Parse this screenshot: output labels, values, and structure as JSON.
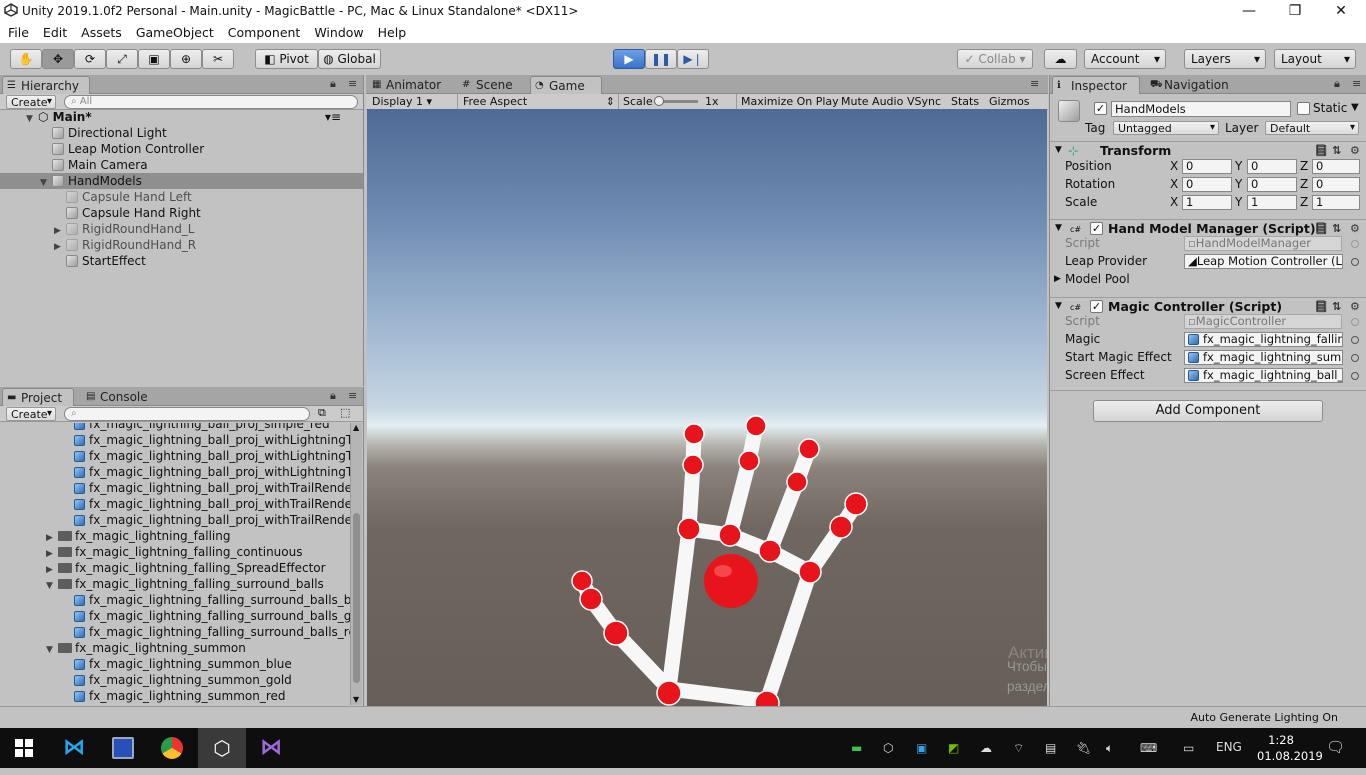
{
  "window": {
    "title": "Unity 2019.1.0f2 Personal - Main.unity - MagicBattle - PC, Mac & Linux Standalone* <DX11>",
    "controls": [
      "—",
      "❐",
      "✕"
    ]
  },
  "menu": [
    "File",
    "Edit",
    "Assets",
    "GameObject",
    "Component",
    "Window",
    "Help"
  ],
  "toolbar": {
    "pivot": "Pivot",
    "global": "Global",
    "collab": "Collab ▾",
    "account": "Account",
    "layers": "Layers",
    "layout": "Layout",
    "tool_icons": [
      "hand-tool-icon",
      "move-tool-icon",
      "rotate-tool-icon",
      "scale-tool-icon",
      "rect-tool-icon",
      "transform-tool-icon",
      "custom-tool-icon"
    ]
  },
  "hierarchy": {
    "tab": "Hierarchy",
    "create": "Create",
    "search_placeholder": "All",
    "scene": "Main*",
    "items": [
      {
        "label": "Directional Light",
        "depth": 1,
        "arrow": "",
        "faded": false,
        "selected": false
      },
      {
        "label": "Leap Motion Controller",
        "depth": 1,
        "arrow": "",
        "faded": false,
        "selected": false
      },
      {
        "label": "Main Camera",
        "depth": 1,
        "arrow": "",
        "faded": false,
        "selected": false
      },
      {
        "label": "HandModels",
        "depth": 1,
        "arrow": "▼",
        "faded": false,
        "selected": true
      },
      {
        "label": "Capsule Hand Left",
        "depth": 2,
        "arrow": "",
        "faded": true,
        "selected": false
      },
      {
        "label": "Capsule Hand Right",
        "depth": 2,
        "arrow": "",
        "faded": false,
        "selected": false
      },
      {
        "label": "RigidRoundHand_L",
        "depth": 2,
        "arrow": "▶",
        "faded": true,
        "selected": false
      },
      {
        "label": "RigidRoundHand_R",
        "depth": 2,
        "arrow": "▶",
        "faded": true,
        "selected": false
      },
      {
        "label": "StartEffect",
        "depth": 2,
        "arrow": "",
        "faded": false,
        "selected": false
      }
    ]
  },
  "project": {
    "tab": "Project",
    "console_tab": "Console",
    "create": "Create",
    "items": [
      {
        "label": "fx_magic_lightning_ball_proj_simple_red",
        "kind": "prefab",
        "arrow": ""
      },
      {
        "label": "fx_magic_lightning_ball_proj_withLightningTra",
        "kind": "prefab",
        "arrow": ""
      },
      {
        "label": "fx_magic_lightning_ball_proj_withLightningTra",
        "kind": "prefab",
        "arrow": ""
      },
      {
        "label": "fx_magic_lightning_ball_proj_withLightningTra",
        "kind": "prefab",
        "arrow": ""
      },
      {
        "label": "fx_magic_lightning_ball_proj_withTrailRender",
        "kind": "prefab",
        "arrow": ""
      },
      {
        "label": "fx_magic_lightning_ball_proj_withTrailRender",
        "kind": "prefab",
        "arrow": ""
      },
      {
        "label": "fx_magic_lightning_ball_proj_withTrailRender",
        "kind": "prefab",
        "arrow": ""
      },
      {
        "label": "fx_magic_lightning_falling",
        "kind": "folder",
        "arrow": "▶"
      },
      {
        "label": "fx_magic_lightning_falling_continuous",
        "kind": "folder",
        "arrow": "▶"
      },
      {
        "label": "fx_magic_lightning_falling_SpreadEffector",
        "kind": "folder",
        "arrow": "▶"
      },
      {
        "label": "fx_magic_lightning_falling_surround_balls",
        "kind": "folder",
        "arrow": "▼"
      },
      {
        "label": "fx_magic_lightning_falling_surround_balls_blu",
        "kind": "prefab",
        "arrow": ""
      },
      {
        "label": "fx_magic_lightning_falling_surround_balls_go",
        "kind": "prefab",
        "arrow": ""
      },
      {
        "label": "fx_magic_lightning_falling_surround_balls_re",
        "kind": "prefab",
        "arrow": ""
      },
      {
        "label": "fx_magic_lightning_summon",
        "kind": "folder",
        "arrow": "▼"
      },
      {
        "label": "fx_magic_lightning_summon_blue",
        "kind": "prefab",
        "arrow": ""
      },
      {
        "label": "fx_magic_lightning_summon_gold",
        "kind": "prefab",
        "arrow": ""
      },
      {
        "label": "fx_magic_lightning_summon_red",
        "kind": "prefab",
        "arrow": ""
      }
    ]
  },
  "center_tabs": {
    "animator": "Animator",
    "scene": "Scene",
    "game": "Game"
  },
  "game_bar": {
    "display": "Display 1",
    "aspect": "Free Aspect",
    "scale_label": "Scale",
    "scale_value": "1x",
    "maximize": "Maximize On Play",
    "mute": "Mute Audio",
    "vsync": "VSync",
    "stats": "Stats",
    "gizmos": "Gizmos"
  },
  "watermark": {
    "line1": "Активация Windows",
    "line2": "Чтобы активировать Windows, перейдите в",
    "line3": "раздел \"Параметры\"."
  },
  "inspector": {
    "tab": "Inspector",
    "nav_tab": "Navigation",
    "object_name": "HandModels",
    "static_label": "Static",
    "tag_label": "Tag",
    "tag_value": "Untagged",
    "layer_label": "Layer",
    "layer_value": "Default",
    "transform": {
      "title": "Transform",
      "rows": [
        {
          "label": "Position",
          "x": "0",
          "y": "0",
          "z": "0"
        },
        {
          "label": "Rotation",
          "x": "0",
          "y": "0",
          "z": "0"
        },
        {
          "label": "Scale",
          "x": "1",
          "y": "1",
          "z": "1"
        }
      ]
    },
    "hand_model_manager": {
      "title": "Hand Model Manager (Script)",
      "script_label": "Script",
      "script_value": "HandModelManager",
      "leap_label": "Leap Provider",
      "leap_value": "Leap Motion Controller (L",
      "pool_label": "Model Pool"
    },
    "magic_controller": {
      "title": "Magic Controller (Script)",
      "script_label": "Script",
      "script_value": "MagicController",
      "magic_label": "Magic",
      "magic_value": "fx_magic_lightning_fallin",
      "start_label": "Start Magic Effect",
      "start_value": "fx_magic_lightning_sumr",
      "screen_label": "Screen Effect",
      "screen_value": "fx_magic_lightning_ball_"
    },
    "add_component": "Add Component"
  },
  "statusbar": {
    "right": "Auto Generate Lighting On"
  },
  "taskbar": {
    "lang": "ENG",
    "time": "1:28",
    "date": "01.08.2019"
  }
}
